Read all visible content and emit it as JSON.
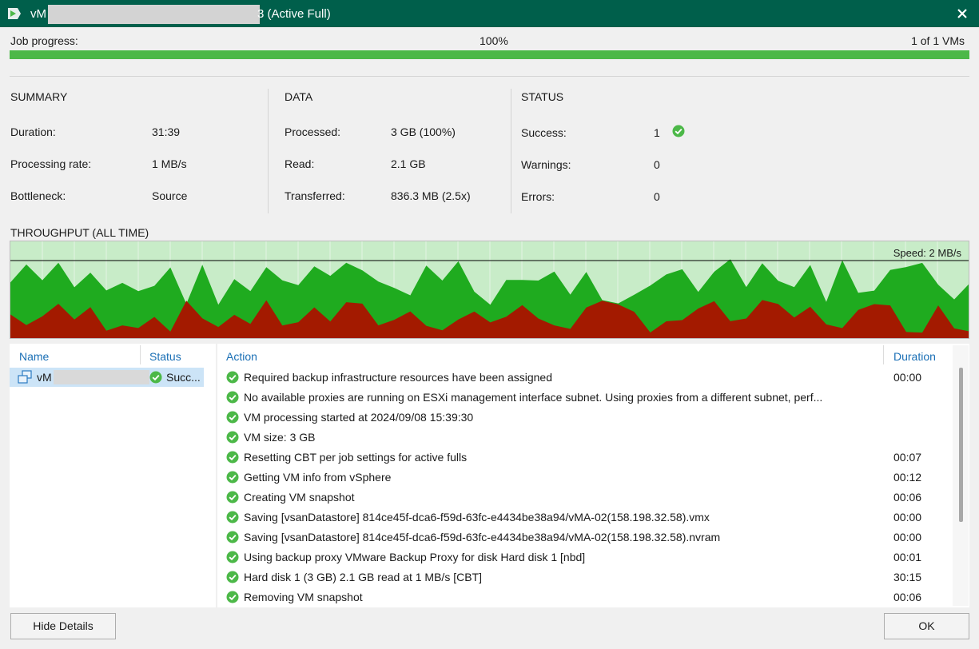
{
  "window": {
    "title_prefix": "vM",
    "title_suffix": "3 (Active Full)",
    "close_icon": "close-icon"
  },
  "progress": {
    "label": "Job progress:",
    "percent_text": "100%",
    "value": 1.0,
    "vms_text": "1 of 1 VMs",
    "fill_color": "#4cb848"
  },
  "summary": {
    "heading": "SUMMARY",
    "rows": [
      {
        "label": "Duration:",
        "value": "31:39"
      },
      {
        "label": "Processing rate:",
        "value": "1 MB/s"
      },
      {
        "label": "Bottleneck:",
        "value": "Source"
      }
    ]
  },
  "data_section": {
    "heading": "DATA",
    "rows": [
      {
        "label": "Processed:",
        "value": "3 GB (100%)"
      },
      {
        "label": "Read:",
        "value": "2.1 GB"
      },
      {
        "label": "Transferred:",
        "value": "836.3 MB (2.5x)"
      }
    ]
  },
  "status_section": {
    "heading": "STATUS",
    "rows": [
      {
        "label": "Success:",
        "value": "1"
      },
      {
        "label": "Warnings:",
        "value": "0"
      },
      {
        "label": "Errors:",
        "value": "0"
      }
    ]
  },
  "throughput": {
    "heading": "THROUGHPUT (ALL TIME)",
    "speed_label": "Speed: 2 MB/s"
  },
  "vm_list": {
    "col_name": "Name",
    "col_status": "Status",
    "rows": [
      {
        "name": "vM",
        "status": "Succ..."
      }
    ]
  },
  "log": {
    "col_action": "Action",
    "col_duration": "Duration",
    "rows": [
      {
        "action": "Required backup infrastructure resources have been assigned",
        "duration": "00:00"
      },
      {
        "action": "No available proxies are running on ESXi management interface subnet. Using proxies from a different subnet, perf...",
        "duration": ""
      },
      {
        "action": "VM processing started at 2024/09/08 15:39:30",
        "duration": ""
      },
      {
        "action": "VM size: 3 GB",
        "duration": ""
      },
      {
        "action": "Resetting CBT per job settings for active fulls",
        "duration": "00:07"
      },
      {
        "action": "Getting VM info from vSphere",
        "duration": "00:12"
      },
      {
        "action": "Creating VM snapshot",
        "duration": "00:06"
      },
      {
        "action": "Saving [vsanDatastore] 814ce45f-dca6-f59d-63fc-e4434be38a94/vMA-02(158.198.32.58).vmx",
        "duration": "00:00"
      },
      {
        "action": "Saving [vsanDatastore] 814ce45f-dca6-f59d-63fc-e4434be38a94/vMA-02(158.198.32.58).nvram",
        "duration": "00:00"
      },
      {
        "action": "Using backup proxy VMware Backup Proxy for disk Hard disk 1 [nbd]",
        "duration": "00:01"
      },
      {
        "action": "Hard disk 1 (3 GB) 2.1 GB read at 1 MB/s [CBT]",
        "duration": "30:15"
      },
      {
        "action": "Removing VM snapshot",
        "duration": "00:06"
      }
    ]
  },
  "buttons": {
    "hide_details": "Hide Details",
    "ok": "OK"
  },
  "colors": {
    "titlebar": "#005f4b",
    "success": "#4cb848",
    "header_blue": "#1a6fb5",
    "chart_green": "#1fab1f",
    "chart_red": "#a31a00"
  }
}
